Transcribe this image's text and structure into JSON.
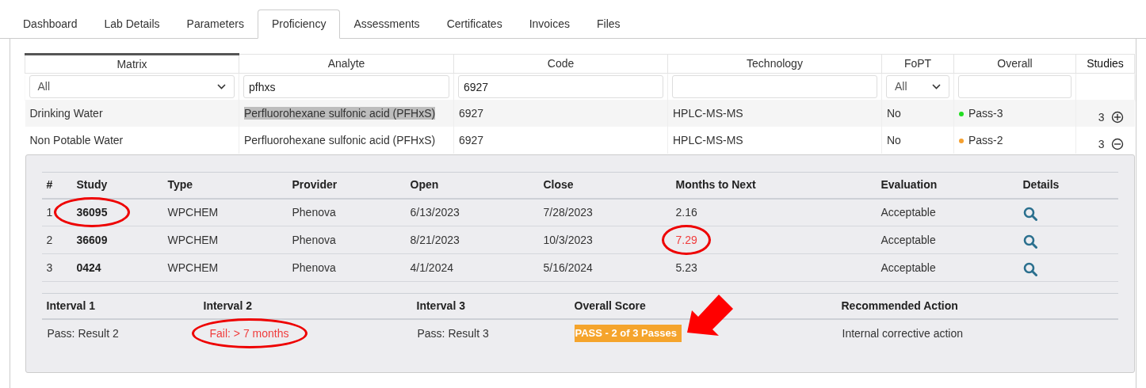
{
  "tabs": [
    {
      "label": "Dashboard",
      "selected": false
    },
    {
      "label": "Lab Details",
      "selected": false
    },
    {
      "label": "Parameters",
      "selected": false
    },
    {
      "label": "Proficiency",
      "selected": true
    },
    {
      "label": "Assessments",
      "selected": false
    },
    {
      "label": "Certificates",
      "selected": false
    },
    {
      "label": "Invoices",
      "selected": false
    },
    {
      "label": "Files",
      "selected": false
    }
  ],
  "table": {
    "columns": [
      {
        "label": "Matrix",
        "sorted": true,
        "bold": false
      },
      {
        "label": "Analyte",
        "sorted": false,
        "bold": false
      },
      {
        "label": "Code",
        "sorted": false,
        "bold": false
      },
      {
        "label": "Technology",
        "sorted": false,
        "bold": false
      },
      {
        "label": "FoPT",
        "sorted": false,
        "bold": false
      },
      {
        "label": "Overall",
        "sorted": false,
        "bold": false
      },
      {
        "label": "Studies",
        "sorted": false,
        "bold": true
      }
    ],
    "filters": [
      {
        "kind": "select",
        "value": "All"
      },
      {
        "kind": "text",
        "value": "pfhxs"
      },
      {
        "kind": "text",
        "value": "6927"
      },
      {
        "kind": "text"
      },
      {
        "kind": "select",
        "value": "All"
      },
      {
        "kind": "text"
      },
      {
        "kind": "none"
      }
    ],
    "rows": [
      {
        "matrix": "Drinking Water",
        "analyte": "Perfluorohexane sulfonic acid (PFHxS)",
        "analyte_highlighted": true,
        "code": "6927",
        "technology": "HPLC-MS-MS",
        "fopt": "No",
        "overall": "Pass-3",
        "color": "#22dd22",
        "studies": "3",
        "expanded": false
      },
      {
        "matrix": "Non Potable Water",
        "analyte": "Perfluorohexane sulfonic acid (PFHxS)",
        "analyte_highlighted": false,
        "code": "6927",
        "technology": "HPLC-MS-MS",
        "fopt": "No",
        "overall": "Pass-2",
        "color": "#f5a030",
        "studies": "3",
        "expanded": true
      }
    ]
  },
  "details": {
    "columns": [
      "#",
      "Study",
      "Type",
      "Provider",
      "Open",
      "Close",
      "Months to Next",
      "Evaluation",
      "Details"
    ],
    "rows": [
      {
        "index": "1",
        "study": "36095",
        "study_circled": true,
        "type": "WPCHEM",
        "provider": "Phenova",
        "open": "6/13/2023",
        "close": "7/28/2023",
        "months": "2.16",
        "months_warning": false,
        "evaluation": "Acceptable"
      },
      {
        "index": "2",
        "study": "36609",
        "study_circled": false,
        "type": "WPCHEM",
        "provider": "Phenova",
        "open": "8/21/2023",
        "close": "10/3/2023",
        "months": "7.29",
        "months_warning": true,
        "evaluation": "Acceptable"
      },
      {
        "index": "3",
        "study": "0424",
        "study_circled": false,
        "type": "WPCHEM",
        "provider": "Phenova",
        "open": "4/1/2024",
        "close": "5/16/2024",
        "months": "5.23",
        "months_warning": false,
        "evaluation": "Acceptable"
      }
    ],
    "summary": [
      {
        "label": "Interval 1",
        "value": "Pass: Result 2",
        "kind": "pass",
        "circled": false
      },
      {
        "label": "Interval 2",
        "value": "Fail: > 7 months",
        "kind": "fail",
        "circled": true
      },
      {
        "label": "Interval 3",
        "value": "Pass: Result 3",
        "kind": "pass",
        "circled": false
      },
      {
        "label": "Overall Score",
        "value": "PASS - 2 of 3 Passes",
        "kind": "badge",
        "circled": false,
        "arrow": true
      },
      {
        "label": "Recommended Action",
        "value": "Internal corrective action",
        "kind": "text",
        "circled": false
      }
    ]
  }
}
